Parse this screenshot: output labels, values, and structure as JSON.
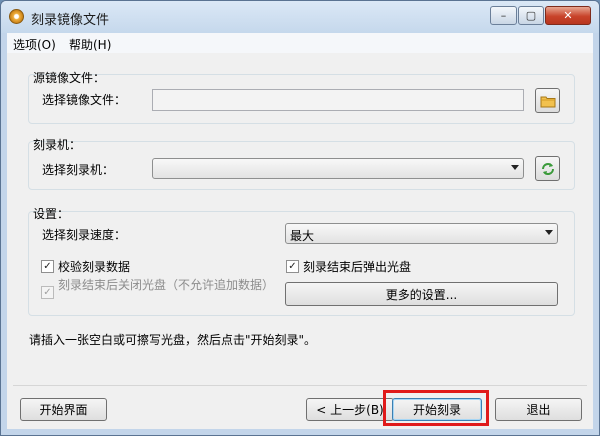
{
  "window": {
    "title": "刻录镜像文件",
    "minimize_symbol": "–",
    "maximize_symbol": "▢",
    "close_symbol": "✕"
  },
  "menu": [
    {
      "label": "选项(O)"
    },
    {
      "label": "帮助(H)"
    }
  ],
  "source": {
    "group_label": "源镜像文件：",
    "field_label": "选择镜像文件：",
    "field_value": "",
    "browse_icon": "folder-icon"
  },
  "burner": {
    "group_label": "刻录机：",
    "field_label": "选择刻录机：",
    "selected": "",
    "refresh_icon": "refresh-icon"
  },
  "settings": {
    "group_label": "设置：",
    "speed_label": "选择刻录速度：",
    "speed_value": "最大",
    "verify_label": "校验刻录数据",
    "verify_checked": true,
    "eject_label": "刻录结束后弹出光盘",
    "eject_checked": true,
    "close_label": "刻录结束后关闭光盘（不允许追加数据）",
    "close_checked": true,
    "close_enabled": false,
    "more_button": "更多的设置..."
  },
  "instruction": "请插入一张空白或可擦写光盘，然后点击\"开始刻录\"。",
  "buttons": {
    "home": "开始界面",
    "back": "< 上一步(B)",
    "start": "开始刻录",
    "exit": "退出"
  },
  "colors": {
    "highlight": "#e01a1a",
    "close_button": "#c8432a"
  }
}
